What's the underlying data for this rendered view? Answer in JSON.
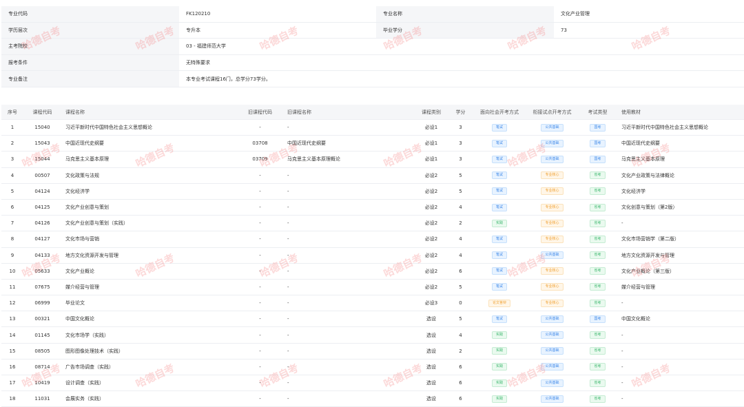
{
  "info": {
    "major_code_label": "专业代码",
    "major_code": "FK120210",
    "major_name_label": "专业名称",
    "major_name": "文化产业管理",
    "level_label": "学历层次",
    "level": "专升本",
    "credits_label": "毕业学分",
    "credits": "73",
    "school_label": "主考院校",
    "school": "03 - 福建师范大学",
    "condition_label": "报考条件",
    "condition": "无特殊要求",
    "remark_label": "专业备注",
    "remark": "本专业考试课程16门，总学分73学分。"
  },
  "table": {
    "headers": [
      "序号",
      "课程代码",
      "课程名称",
      "旧课程代码",
      "旧课程名称",
      "课程类别",
      "学分",
      "面向社会开考方式",
      "衔接试点开考方式",
      "考试类型",
      "使用教材"
    ],
    "rows": [
      {
        "no": "1",
        "code": "15040",
        "name": "习近平新时代中国特色社会主义思想概论",
        "old_code": "-",
        "old_name": "-",
        "type": "必设1",
        "credit": "3",
        "social": "笔试",
        "pilot": "公共基础",
        "exam": "国考",
        "book": "习近平新时代中国特色社会主义思想概论"
      },
      {
        "no": "2",
        "code": "15043",
        "name": "中国近现代史纲要",
        "old_code": "03708",
        "old_name": "中国近现代史纲要",
        "type": "必设1",
        "credit": "3",
        "social": "笔试",
        "pilot": "公共基础",
        "exam": "国考",
        "book": "中国近现代史纲要"
      },
      {
        "no": "3",
        "code": "15044",
        "name": "马克思主义基本原理",
        "old_code": "03709",
        "old_name": "马克思主义基本原理概论",
        "type": "必设1",
        "credit": "3",
        "social": "笔试",
        "pilot": "公共基础",
        "exam": "国考",
        "book": "马克思主义基本原理"
      },
      {
        "no": "4",
        "code": "00507",
        "name": "文化政策与法规",
        "old_code": "-",
        "old_name": "-",
        "type": "必设2",
        "credit": "5",
        "social": "笔试",
        "pilot": "专业核心",
        "exam": "省考",
        "book": "文化产业政策与法律概论"
      },
      {
        "no": "5",
        "code": "04124",
        "name": "文化经济学",
        "old_code": "-",
        "old_name": "-",
        "type": "必设2",
        "credit": "5",
        "social": "笔试",
        "pilot": "专业核心",
        "exam": "省考",
        "book": "文化经济学"
      },
      {
        "no": "6",
        "code": "04125",
        "name": "文化产业创意与策划",
        "old_code": "-",
        "old_name": "-",
        "type": "必设2",
        "credit": "4",
        "social": "笔试",
        "pilot": "专业核心",
        "exam": "省考",
        "book": "文化创意与策划（第2版）"
      },
      {
        "no": "7",
        "code": "04126",
        "name": "文化产业创意与策划（实践）",
        "old_code": "-",
        "old_name": "-",
        "type": "必设2",
        "credit": "2",
        "social": "实践",
        "pilot": "专业核心",
        "exam": "省考",
        "book": "-"
      },
      {
        "no": "8",
        "code": "04127",
        "name": "文化市场与营销",
        "old_code": "-",
        "old_name": "-",
        "type": "必设2",
        "credit": "4",
        "social": "笔试",
        "pilot": "专业核心",
        "exam": "省考",
        "book": "文化市场营销学（第二版）"
      },
      {
        "no": "9",
        "code": "04133",
        "name": "地方文化资源开发与管理",
        "old_code": "-",
        "old_name": "-",
        "type": "必设2",
        "credit": "4",
        "social": "笔试",
        "pilot": "公共基础",
        "exam": "省考",
        "book": "地方文化资源开发与管理"
      },
      {
        "no": "10",
        "code": "05633",
        "name": "文化产业概论",
        "old_code": "-",
        "old_name": "-",
        "type": "必设2",
        "credit": "6",
        "social": "笔试",
        "pilot": "专业核心",
        "exam": "省考",
        "book": "文化产业概论（第三版）"
      },
      {
        "no": "11",
        "code": "07675",
        "name": "媒介经营与管理",
        "old_code": "-",
        "old_name": "-",
        "type": "必设2",
        "credit": "5",
        "social": "笔试",
        "pilot": "专业核心",
        "exam": "省考",
        "book": "媒介经营与管理"
      },
      {
        "no": "12",
        "code": "06999",
        "name": "毕业论文",
        "old_code": "-",
        "old_name": "-",
        "type": "必设3",
        "credit": "0",
        "social": "论文答辩",
        "pilot": "专业核心",
        "exam": "省考",
        "book": "-"
      },
      {
        "no": "13",
        "code": "00321",
        "name": "中国文化概论",
        "old_code": "-",
        "old_name": "-",
        "type": "选设",
        "credit": "5",
        "social": "笔试",
        "pilot": "公共基础",
        "exam": "国考",
        "book": "中国文化概论"
      },
      {
        "no": "14",
        "code": "01145",
        "name": "文化市场学（实践）",
        "old_code": "-",
        "old_name": "-",
        "type": "选设",
        "credit": "4",
        "social": "实践",
        "pilot": "公共基础",
        "exam": "省考",
        "book": "-"
      },
      {
        "no": "15",
        "code": "08505",
        "name": "图形图像处理技术（实践）",
        "old_code": "-",
        "old_name": "-",
        "type": "选设",
        "credit": "2",
        "social": "实践",
        "pilot": "公共基础",
        "exam": "省考",
        "book": "-"
      },
      {
        "no": "16",
        "code": "08714",
        "name": "广告市场调查（实践）",
        "old_code": "-",
        "old_name": "-",
        "type": "选设",
        "credit": "6",
        "social": "实践",
        "pilot": "公共基础",
        "exam": "省考",
        "book": "-"
      },
      {
        "no": "17",
        "code": "10419",
        "name": "设计调查（实践）",
        "old_code": "-",
        "old_name": "-",
        "type": "选设",
        "credit": "6",
        "social": "实践",
        "pilot": "公共基础",
        "exam": "省考",
        "book": "-"
      },
      {
        "no": "18",
        "code": "11031",
        "name": "会展实务（实践）",
        "old_code": "-",
        "old_name": "-",
        "type": "选设",
        "credit": "6",
        "social": "实践",
        "pilot": "公共基础",
        "exam": "省考",
        "book": "-"
      }
    ]
  },
  "watermark": "哈德自考",
  "colors": {
    "blue": "#3a86e8",
    "green": "#38b56a",
    "orange": "#f0a030"
  }
}
